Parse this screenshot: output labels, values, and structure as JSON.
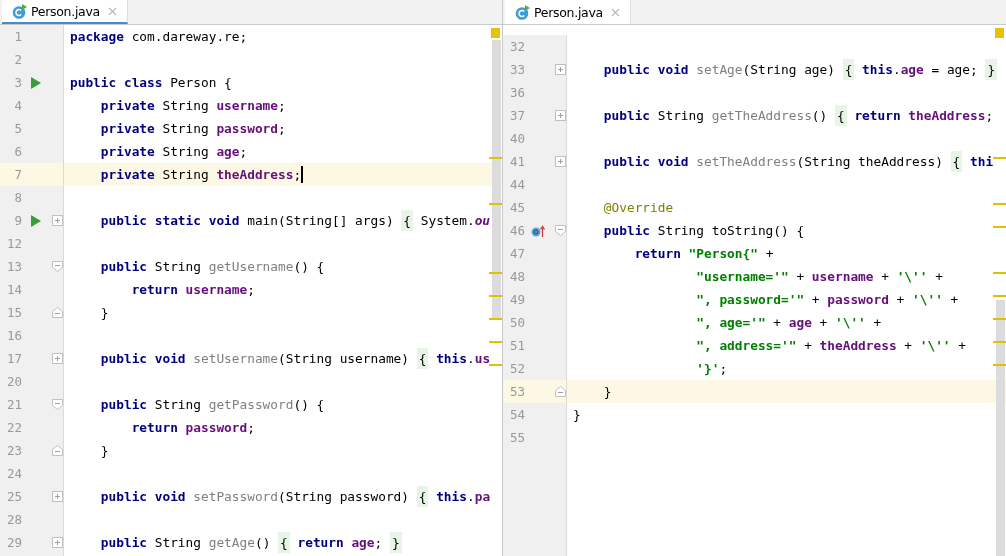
{
  "panes": [
    {
      "tab": {
        "label": "Person.java",
        "selected": true
      },
      "focused": true,
      "lines": [
        {
          "number": "1",
          "current": false,
          "tokens": [
            {
              "kind": "keyword",
              "text": "package"
            },
            {
              "kind": "plain",
              "text": " com.dareway.re;"
            }
          ]
        },
        {
          "number": "2",
          "current": false
        },
        {
          "number": "3",
          "current": false,
          "gutter_icon": {
            "kind": "run"
          },
          "tokens": [
            {
              "kind": "keyword",
              "text": "public class"
            },
            {
              "kind": "plain",
              "text": " Person {"
            }
          ]
        },
        {
          "number": "4",
          "current": false,
          "tokens": [
            {
              "kind": "keyword",
              "text": "    private"
            },
            {
              "kind": "plain",
              "text": " String "
            },
            {
              "kind": "field",
              "text": "username"
            },
            {
              "kind": "plain",
              "text": ";"
            }
          ]
        },
        {
          "number": "5",
          "current": false,
          "tokens": [
            {
              "kind": "keyword",
              "text": "    private"
            },
            {
              "kind": "plain",
              "text": " String "
            },
            {
              "kind": "field",
              "text": "password"
            },
            {
              "kind": "plain",
              "text": ";"
            }
          ]
        },
        {
          "number": "6",
          "current": false,
          "tokens": [
            {
              "kind": "keyword",
              "text": "    private"
            },
            {
              "kind": "plain",
              "text": " String "
            },
            {
              "kind": "field",
              "text": "age"
            },
            {
              "kind": "plain",
              "text": ";"
            }
          ]
        },
        {
          "number": "7",
          "current": true,
          "tokens": [
            {
              "kind": "keyword",
              "text": "    private"
            },
            {
              "kind": "plain",
              "text": " String "
            },
            {
              "kind": "field",
              "text": "theAddress"
            },
            {
              "kind": "plain",
              "text": ";"
            }
          ]
        },
        {
          "number": "8",
          "current": false
        },
        {
          "number": "9",
          "current": false,
          "gutter_icon": {
            "kind": "run"
          },
          "fold": {
            "kind": "expand"
          },
          "tokens": [
            {
              "kind": "keyword",
              "text": "    public static void"
            },
            {
              "kind": "plain",
              "text": " main(String[] args) "
            },
            {
              "kind": "fold",
              "text": "{"
            },
            {
              "kind": "plain",
              "text": " System."
            },
            {
              "kind": "static",
              "text": "ou"
            }
          ]
        },
        {
          "number": "12",
          "current": false
        },
        {
          "number": "13",
          "current": false,
          "fold": {
            "kind": "collapse"
          },
          "tokens": [
            {
              "kind": "keyword",
              "text": "    public"
            },
            {
              "kind": "plain",
              "text": " String "
            },
            {
              "kind": "unused",
              "text": "getUsername"
            },
            {
              "kind": "plain",
              "text": "() {"
            }
          ]
        },
        {
          "number": "14",
          "current": false,
          "tokens": [
            {
              "kind": "keyword",
              "text": "        return"
            },
            {
              "kind": "field",
              "text": " username"
            },
            {
              "kind": "plain",
              "text": ";"
            }
          ]
        },
        {
          "number": "15",
          "current": false,
          "fold": {
            "kind": "end"
          },
          "tokens": [
            {
              "kind": "plain",
              "text": "    }"
            }
          ]
        },
        {
          "number": "16",
          "current": false
        },
        {
          "number": "17",
          "current": false,
          "fold": {
            "kind": "expand"
          },
          "tokens": [
            {
              "kind": "keyword",
              "text": "    public void"
            },
            {
              "kind": "unused",
              "text": " setUsername"
            },
            {
              "kind": "plain",
              "text": "(String username) "
            },
            {
              "kind": "fold",
              "text": "{"
            },
            {
              "kind": "keyword",
              "text": " this"
            },
            {
              "kind": "plain",
              "text": "."
            },
            {
              "kind": "field",
              "text": "us"
            }
          ]
        },
        {
          "number": "20",
          "current": false
        },
        {
          "number": "21",
          "current": false,
          "fold": {
            "kind": "collapse"
          },
          "tokens": [
            {
              "kind": "keyword",
              "text": "    public"
            },
            {
              "kind": "plain",
              "text": " String "
            },
            {
              "kind": "unused",
              "text": "getPassword"
            },
            {
              "kind": "plain",
              "text": "() {"
            }
          ]
        },
        {
          "number": "22",
          "current": false,
          "tokens": [
            {
              "kind": "keyword",
              "text": "        return"
            },
            {
              "kind": "field",
              "text": " password"
            },
            {
              "kind": "plain",
              "text": ";"
            }
          ]
        },
        {
          "number": "23",
          "current": false,
          "fold": {
            "kind": "end"
          },
          "tokens": [
            {
              "kind": "plain",
              "text": "    }"
            }
          ]
        },
        {
          "number": "24",
          "current": false
        },
        {
          "number": "25",
          "current": false,
          "fold": {
            "kind": "expand"
          },
          "tokens": [
            {
              "kind": "keyword",
              "text": "    public void"
            },
            {
              "kind": "unused",
              "text": " setPassword"
            },
            {
              "kind": "plain",
              "text": "(String password) "
            },
            {
              "kind": "fold",
              "text": "{"
            },
            {
              "kind": "keyword",
              "text": " this"
            },
            {
              "kind": "plain",
              "text": "."
            },
            {
              "kind": "field",
              "text": "pa"
            }
          ]
        },
        {
          "number": "28",
          "current": false
        },
        {
          "number": "29",
          "current": false,
          "fold": {
            "kind": "expand"
          },
          "tokens": [
            {
              "kind": "keyword",
              "text": "    public"
            },
            {
              "kind": "plain",
              "text": " String "
            },
            {
              "kind": "unused",
              "text": "getAge"
            },
            {
              "kind": "plain",
              "text": "() "
            },
            {
              "kind": "fold",
              "text": "{"
            },
            {
              "kind": "keyword",
              "text": " return"
            },
            {
              "kind": "field",
              "text": " age"
            },
            {
              "kind": "plain",
              "text": "; "
            },
            {
              "kind": "fold",
              "text": "}"
            }
          ]
        }
      ]
    },
    {
      "tab": {
        "label": "Person.java",
        "selected": true
      },
      "focused": false,
      "lines": [
        {
          "number": "32",
          "current": false
        },
        {
          "number": "33",
          "current": false,
          "fold": {
            "kind": "expand"
          },
          "tokens": [
            {
              "kind": "keyword",
              "text": "    public void"
            },
            {
              "kind": "unused",
              "text": " setAge"
            },
            {
              "kind": "plain",
              "text": "(String age) "
            },
            {
              "kind": "fold",
              "text": "{"
            },
            {
              "kind": "keyword",
              "text": " this"
            },
            {
              "kind": "plain",
              "text": "."
            },
            {
              "kind": "field",
              "text": "age"
            },
            {
              "kind": "plain",
              "text": " = age; "
            },
            {
              "kind": "fold",
              "text": "}"
            }
          ]
        },
        {
          "number": "36",
          "current": false
        },
        {
          "number": "37",
          "current": false,
          "fold": {
            "kind": "expand"
          },
          "tokens": [
            {
              "kind": "keyword",
              "text": "    public"
            },
            {
              "kind": "plain",
              "text": " String "
            },
            {
              "kind": "unused",
              "text": "getTheAddress"
            },
            {
              "kind": "plain",
              "text": "() "
            },
            {
              "kind": "fold",
              "text": "{"
            },
            {
              "kind": "keyword",
              "text": " return"
            },
            {
              "kind": "field",
              "text": " theAddress"
            },
            {
              "kind": "plain",
              "text": ";"
            }
          ]
        },
        {
          "number": "40",
          "current": false
        },
        {
          "number": "41",
          "current": false,
          "fold": {
            "kind": "expand"
          },
          "tokens": [
            {
              "kind": "keyword",
              "text": "    public void"
            },
            {
              "kind": "unused",
              "text": " setTheAddress"
            },
            {
              "kind": "plain",
              "text": "(String theAddress) "
            },
            {
              "kind": "fold",
              "text": "{"
            },
            {
              "kind": "keyword",
              "text": " thi"
            }
          ]
        },
        {
          "number": "44",
          "current": false
        },
        {
          "number": "45",
          "current": false,
          "tokens": [
            {
              "kind": "annotation",
              "text": "    @Override"
            }
          ]
        },
        {
          "number": "46",
          "current": false,
          "gutter_icon": {
            "kind": "override"
          },
          "fold": {
            "kind": "collapse"
          },
          "tokens": [
            {
              "kind": "keyword",
              "text": "    public"
            },
            {
              "kind": "plain",
              "text": " String toString() {"
            }
          ]
        },
        {
          "number": "47",
          "current": false,
          "tokens": [
            {
              "kind": "keyword",
              "text": "        return"
            },
            {
              "kind": "string",
              "text": " \"Person{\""
            },
            {
              "kind": "plain",
              "text": " +"
            }
          ]
        },
        {
          "number": "48",
          "current": false,
          "tokens": [
            {
              "kind": "string",
              "text": "                \"username='\""
            },
            {
              "kind": "plain",
              "text": " + "
            },
            {
              "kind": "field",
              "text": "username"
            },
            {
              "kind": "plain",
              "text": " + "
            },
            {
              "kind": "string",
              "text": "'\\''"
            },
            {
              "kind": "plain",
              "text": " +"
            }
          ]
        },
        {
          "number": "49",
          "current": false,
          "tokens": [
            {
              "kind": "string",
              "text": "                \", password='\""
            },
            {
              "kind": "plain",
              "text": " + "
            },
            {
              "kind": "field",
              "text": "password"
            },
            {
              "kind": "plain",
              "text": " + "
            },
            {
              "kind": "string",
              "text": "'\\''"
            },
            {
              "kind": "plain",
              "text": " +"
            }
          ]
        },
        {
          "number": "50",
          "current": false,
          "tokens": [
            {
              "kind": "string",
              "text": "                \", age='\""
            },
            {
              "kind": "plain",
              "text": " + "
            },
            {
              "kind": "field",
              "text": "age"
            },
            {
              "kind": "plain",
              "text": " + "
            },
            {
              "kind": "string",
              "text": "'\\''"
            },
            {
              "kind": "plain",
              "text": " +"
            }
          ]
        },
        {
          "number": "51",
          "current": false,
          "tokens": [
            {
              "kind": "string",
              "text": "                \", address='\""
            },
            {
              "kind": "plain",
              "text": " + "
            },
            {
              "kind": "field",
              "text": "theAddress"
            },
            {
              "kind": "plain",
              "text": " + "
            },
            {
              "kind": "string",
              "text": "'\\''"
            },
            {
              "kind": "plain",
              "text": " +"
            }
          ]
        },
        {
          "number": "52",
          "current": false,
          "tokens": [
            {
              "kind": "string",
              "text": "                '}'"
            },
            {
              "kind": "plain",
              "text": ";"
            }
          ]
        },
        {
          "number": "53",
          "current": true,
          "fold": {
            "kind": "end"
          },
          "tokens": [
            {
              "kind": "plain",
              "text": "    }"
            }
          ]
        },
        {
          "number": "54",
          "current": false,
          "tokens": [
            {
              "kind": "plain",
              "text": "}"
            }
          ]
        },
        {
          "number": "55",
          "current": false
        }
      ]
    }
  ]
}
